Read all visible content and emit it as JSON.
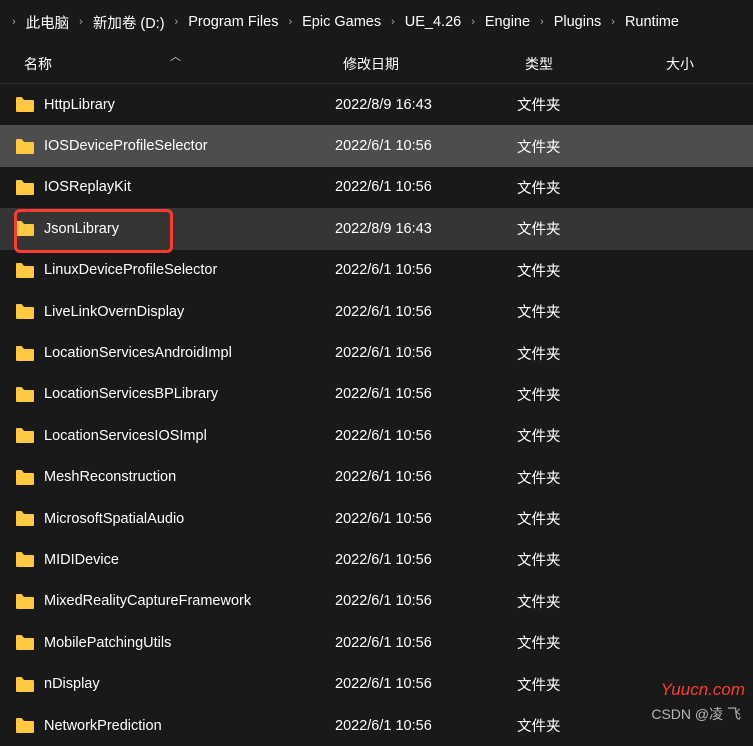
{
  "breadcrumb": [
    "此电脑",
    "新加卷 (D:)",
    "Program Files",
    "Epic Games",
    "UE_4.26",
    "Engine",
    "Plugins",
    "Runtime"
  ],
  "columns": {
    "name": "名称",
    "date": "修改日期",
    "type": "类型",
    "size": "大小"
  },
  "type_folder": "文件夹",
  "rows": [
    {
      "name": "HttpLibrary",
      "date": "2022/8/9 16:43",
      "selected": false,
      "outlined": false
    },
    {
      "name": "IOSDeviceProfileSelector",
      "date": "2022/6/1 10:56",
      "selected": true,
      "outlined": false
    },
    {
      "name": "IOSReplayKit",
      "date": "2022/6/1 10:56",
      "selected": false,
      "outlined": false
    },
    {
      "name": "JsonLibrary",
      "date": "2022/8/9 16:43",
      "selected": false,
      "outlined": true
    },
    {
      "name": "LinuxDeviceProfileSelector",
      "date": "2022/6/1 10:56",
      "selected": false,
      "outlined": false
    },
    {
      "name": "LiveLinkOvernDisplay",
      "date": "2022/6/1 10:56",
      "selected": false,
      "outlined": false
    },
    {
      "name": "LocationServicesAndroidImpl",
      "date": "2022/6/1 10:56",
      "selected": false,
      "outlined": false
    },
    {
      "name": "LocationServicesBPLibrary",
      "date": "2022/6/1 10:56",
      "selected": false,
      "outlined": false
    },
    {
      "name": "LocationServicesIOSImpl",
      "date": "2022/6/1 10:56",
      "selected": false,
      "outlined": false
    },
    {
      "name": "MeshReconstruction",
      "date": "2022/6/1 10:56",
      "selected": false,
      "outlined": false
    },
    {
      "name": "MicrosoftSpatialAudio",
      "date": "2022/6/1 10:56",
      "selected": false,
      "outlined": false
    },
    {
      "name": "MIDIDevice",
      "date": "2022/6/1 10:56",
      "selected": false,
      "outlined": false
    },
    {
      "name": "MixedRealityCaptureFramework",
      "date": "2022/6/1 10:56",
      "selected": false,
      "outlined": false
    },
    {
      "name": "MobilePatchingUtils",
      "date": "2022/6/1 10:56",
      "selected": false,
      "outlined": false
    },
    {
      "name": "nDisplay",
      "date": "2022/6/1 10:56",
      "selected": false,
      "outlined": false
    },
    {
      "name": "NetworkPrediction",
      "date": "2022/6/1 10:56",
      "selected": false,
      "outlined": false
    }
  ],
  "watermark1": "Yuucn.com",
  "watermark2": "CSDN @凌 飞"
}
